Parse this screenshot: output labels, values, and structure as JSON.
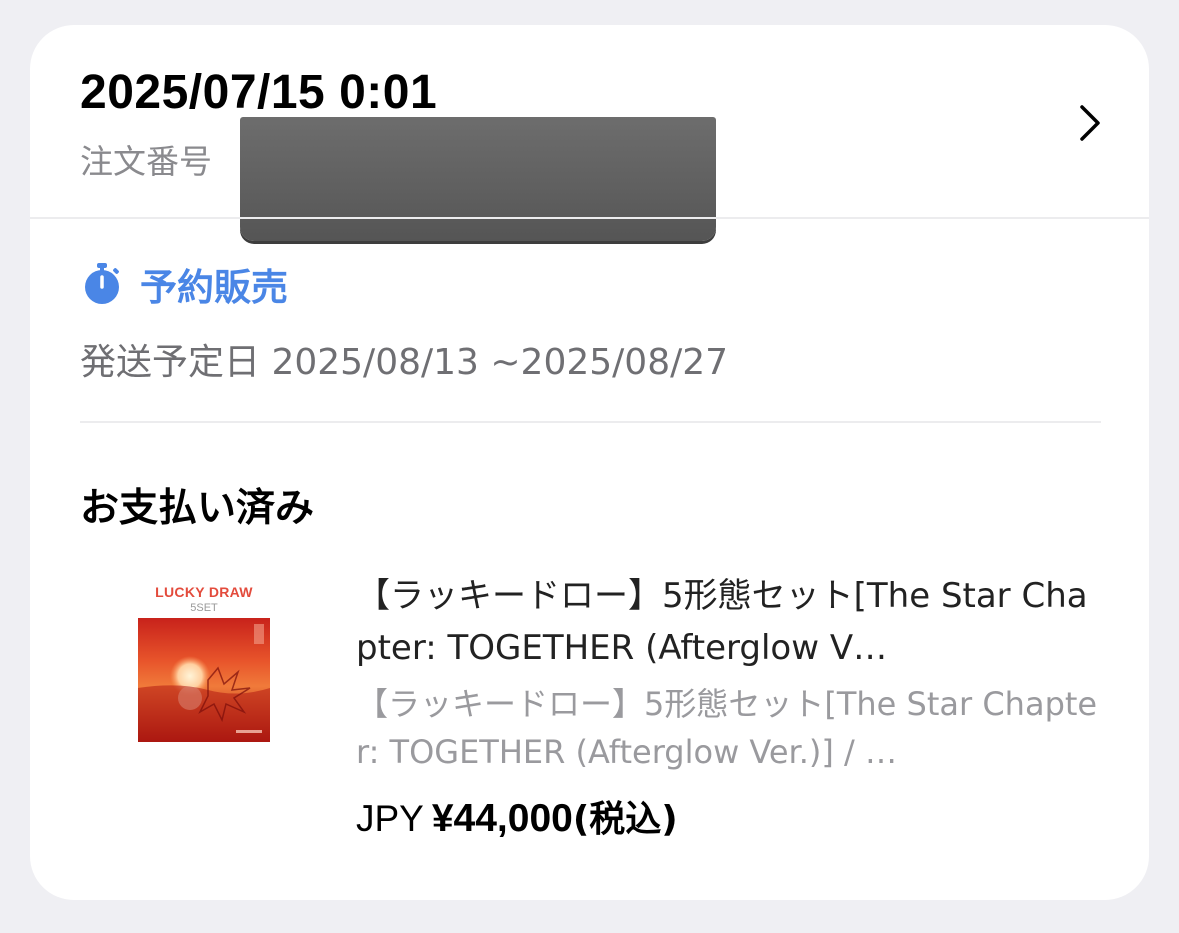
{
  "order": {
    "date_time": "2025/07/15 0:01",
    "number_label": "注文番号"
  },
  "preorder": {
    "icon": "timer-icon",
    "label": "予約販売",
    "accent_color": "#4a86e6"
  },
  "shipping": {
    "text": "発送予定日 2025/08/13 ~2025/08/27"
  },
  "payment": {
    "status": "お支払い済み"
  },
  "product": {
    "thumb_title": "LUCKY DRAW",
    "thumb_subtitle": "5SET",
    "title": "【ラッキードロー】5形態セット[The Star Chapter: TOGETHER (Afterglow V…",
    "subtitle": "【ラッキードロー】5形態セット[The Star Chapter: TOGETHER (Afterglow Ver.)] / …",
    "currency": "JPY",
    "price": "¥44,000",
    "tax_note": "(税込)"
  }
}
